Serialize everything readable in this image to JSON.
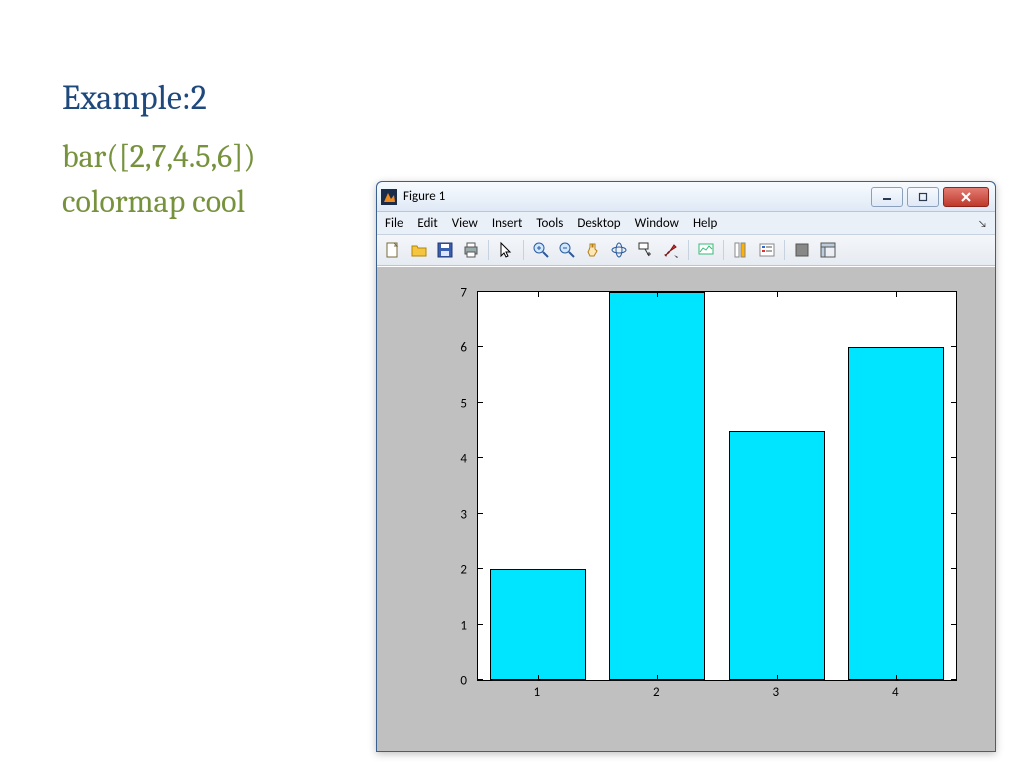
{
  "slide": {
    "heading": "Example:2",
    "code_line_1": "bar([2,7,4.5,6])",
    "code_line_2": "colormap cool"
  },
  "window": {
    "title": "Figure 1",
    "menus": [
      "File",
      "Edit",
      "View",
      "Insert",
      "Tools",
      "Desktop",
      "Window",
      "Help"
    ],
    "buttons": {
      "minimize": "—",
      "maximize": "▢",
      "close": "X"
    }
  },
  "toolbar_icons": [
    "new-file-icon",
    "open-icon",
    "save-icon",
    "print-icon",
    "sep",
    "pointer-icon",
    "sep",
    "zoom-in-icon",
    "zoom-out-icon",
    "pan-icon",
    "rotate-3d-icon",
    "data-cursor-icon",
    "brush-icon",
    "sep",
    "link-plots-icon",
    "sep",
    "colorbar-icon",
    "legend-icon",
    "sep",
    "hide-plot-tools-icon",
    "show-plot-tools-icon"
  ],
  "chart_data": {
    "type": "bar",
    "categories": [
      "1",
      "2",
      "3",
      "4"
    ],
    "values": [
      2,
      7,
      4.5,
      6
    ],
    "yticks": [
      0,
      1,
      2,
      3,
      4,
      5,
      6,
      7
    ],
    "ylim": [
      0,
      7
    ],
    "xlabel": "",
    "ylabel": "",
    "title": "",
    "bar_color": "#00e5ff"
  }
}
